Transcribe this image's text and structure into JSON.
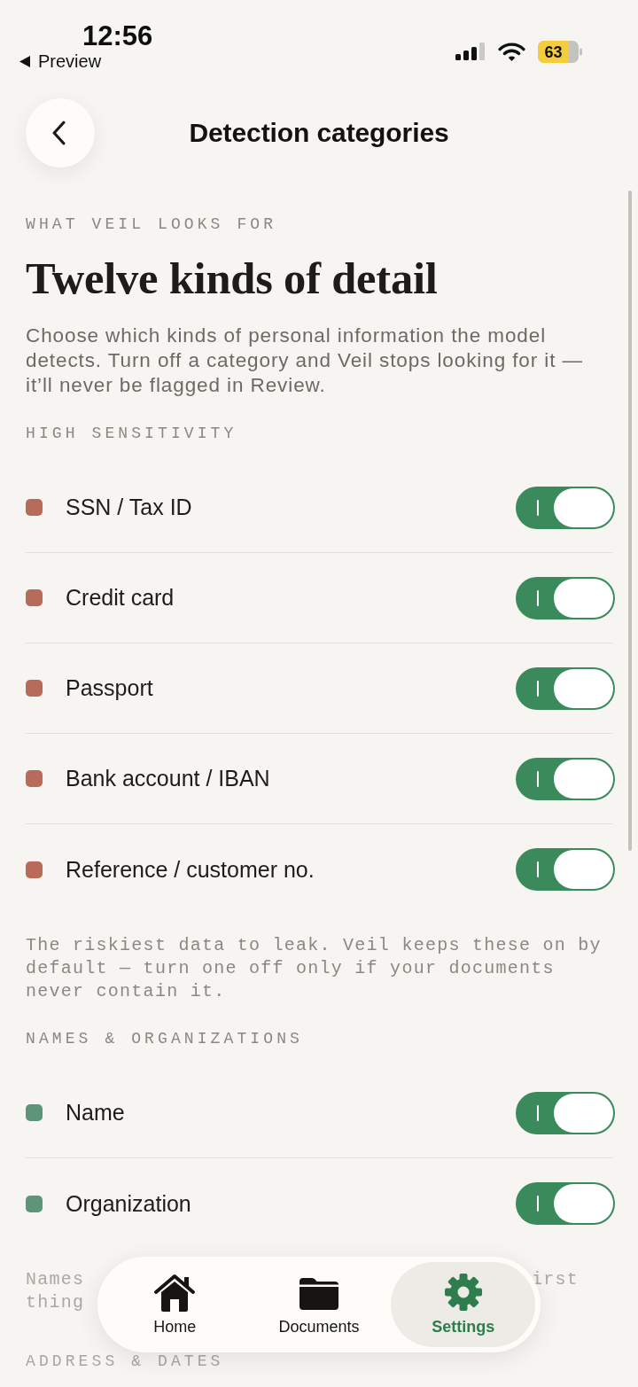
{
  "status_bar": {
    "time": "12:56",
    "back_link": "Preview",
    "battery": "63"
  },
  "header": {
    "title": "Detection categories"
  },
  "intro": {
    "eyebrow": "WHAT VEIL LOOKS FOR",
    "heading": "Twelve kinds of detail",
    "description": "Choose which kinds of personal information the model detects. Turn off a category and Veil stops looking for it — it’ll never be flagged in Review."
  },
  "sections": [
    {
      "label": "HIGH SENSITIVITY",
      "items": [
        {
          "name": "SSN / Tax ID",
          "color": "#b96b5b",
          "on": true
        },
        {
          "name": "Credit card",
          "color": "#b96b5b",
          "on": true
        },
        {
          "name": "Passport",
          "color": "#b96b5b",
          "on": true
        },
        {
          "name": "Bank account / IBAN",
          "color": "#b96b5b",
          "on": true
        },
        {
          "name": "Reference / customer no.",
          "color": "#b96b5b",
          "on": true
        }
      ],
      "note": "The riskiest data to leak. Veil keeps these on by default — turn one off only if your documents never contain it."
    },
    {
      "label": "NAMES & ORGANIZATIONS",
      "items": [
        {
          "name": "Name",
          "color": "#5e957a",
          "on": true
        },
        {
          "name": "Organization",
          "color": "#5e957a",
          "on": true
        }
      ],
      "note_lines": [
        {
          "start": "Names",
          "end": "irst"
        },
        {
          "start": "thing"
        }
      ]
    },
    {
      "label": "ADDRESS & DATES"
    }
  ],
  "nav": {
    "items": [
      {
        "label": "Home",
        "selected": false
      },
      {
        "label": "Documents",
        "selected": false
      },
      {
        "label": "Settings",
        "selected": true
      }
    ]
  }
}
